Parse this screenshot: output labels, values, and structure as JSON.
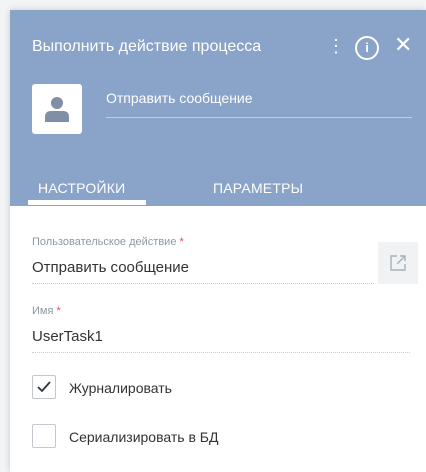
{
  "dialog": {
    "title": "Выполнить действие процесса",
    "kebab_glyph": "⋮",
    "info_glyph": "i",
    "close_glyph": "✕",
    "name_value": "Отправить сообщение"
  },
  "tabs": [
    {
      "label": "НАСТРОЙКИ",
      "active": true
    },
    {
      "label": "ПАРАМЕТРЫ",
      "active": false
    }
  ],
  "fields": {
    "user_action": {
      "label": "Пользовательское действие",
      "required_mark": "*",
      "value": "Отправить сообщение"
    },
    "name": {
      "label": "Имя",
      "required_mark": "*",
      "value": "UserTask1"
    }
  },
  "checkboxes": [
    {
      "label": "Журналировать",
      "checked": true
    },
    {
      "label": "Сериализировать в БД",
      "checked": false
    }
  ],
  "colors": {
    "header_bg": "#8aa3c9",
    "required": "#e84b4b"
  }
}
